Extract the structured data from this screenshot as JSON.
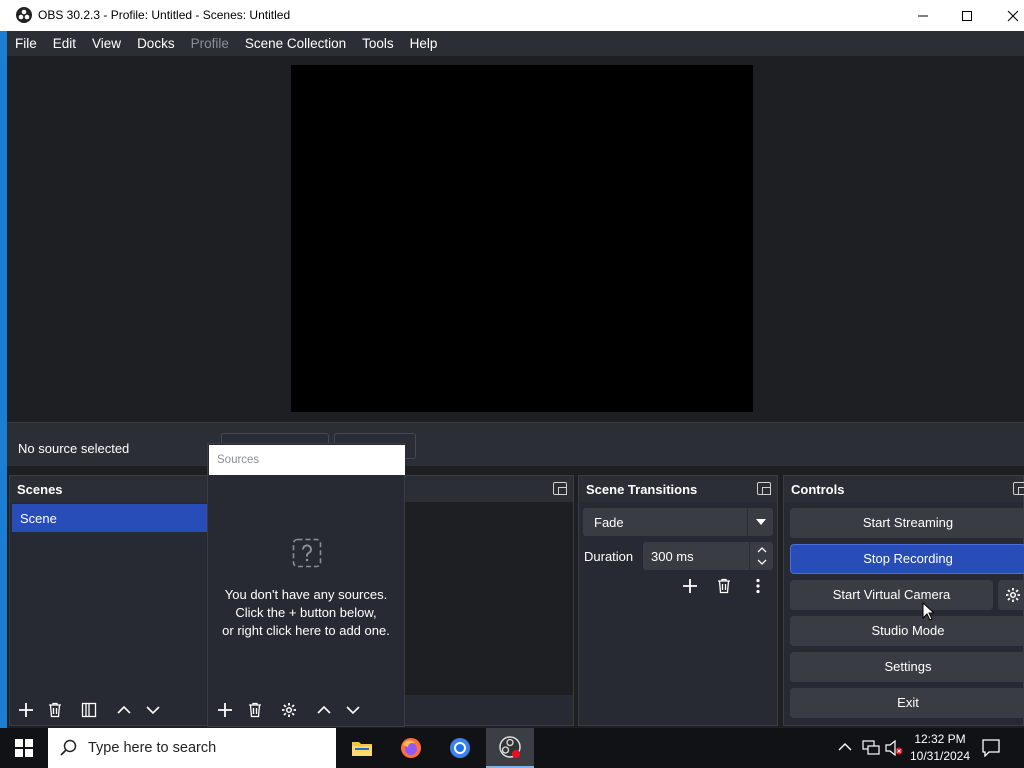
{
  "window": {
    "title": "OBS 30.2.3 - Profile: Untitled - Scenes: Untitled"
  },
  "menu": {
    "items": [
      "File",
      "Edit",
      "View",
      "Docks",
      "Profile",
      "Scene Collection",
      "Tools",
      "Help"
    ]
  },
  "context_bar": {
    "no_source": "No source selected"
  },
  "scenes": {
    "title": "Scenes",
    "items": [
      "Scene"
    ]
  },
  "sources": {
    "title": "Sources",
    "empty_line1": "You don't have any sources.",
    "empty_line2": "Click the + button below,",
    "empty_line3": "or right click here to add one."
  },
  "transitions": {
    "title": "Scene Transitions",
    "selected": "Fade",
    "duration_label": "Duration",
    "duration_value": "300 ms"
  },
  "controls": {
    "title": "Controls",
    "start_streaming": "Start Streaming",
    "stop_recording": "Stop Recording",
    "start_virtual_camera": "Start Virtual Camera",
    "studio_mode": "Studio Mode",
    "settings": "Settings",
    "exit": "Exit"
  },
  "taskbar": {
    "search_placeholder": "Type here to search",
    "time": "12:32 PM",
    "date": "10/31/2024"
  },
  "colors": {
    "accent": "#284cb8",
    "panel": "#272a33",
    "background": "#1e1f23"
  }
}
